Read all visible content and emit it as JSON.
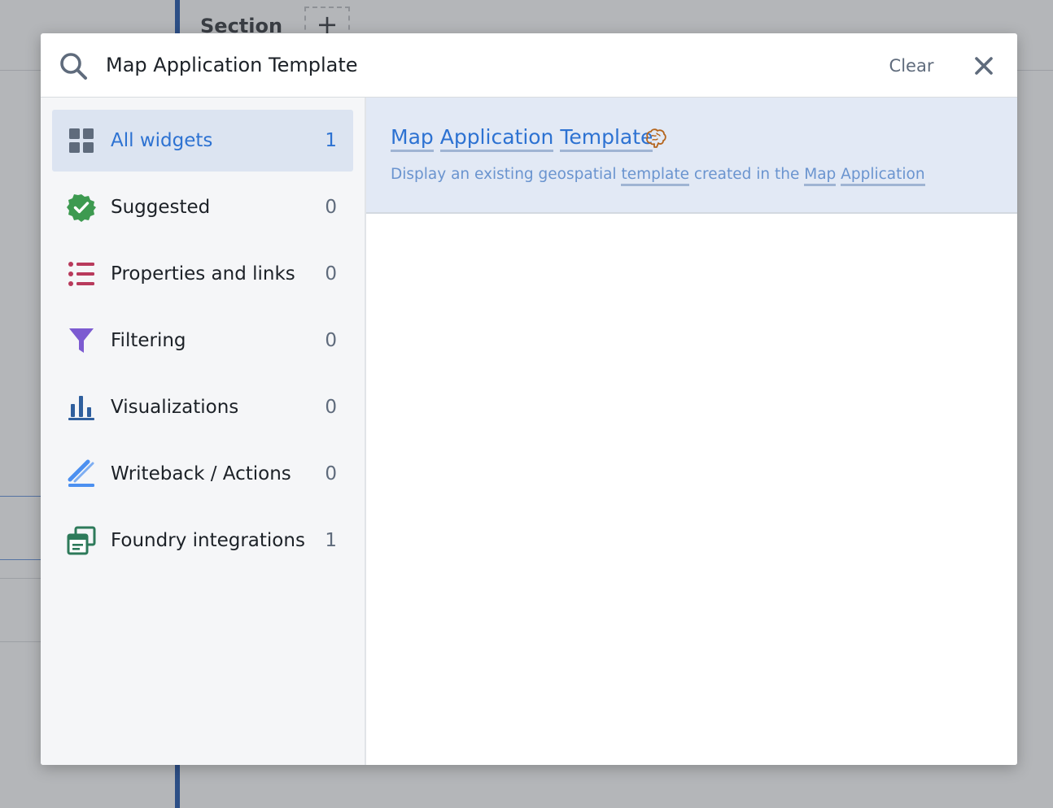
{
  "background": {
    "section_label": "Section",
    "add_symbol": "+"
  },
  "search": {
    "value": "Map Application Template",
    "clear_label": "Clear",
    "icon": "search-icon",
    "close_icon": "close-icon"
  },
  "categories": [
    {
      "label": "All widgets",
      "count": "1",
      "icon": "grid-icon",
      "active": true
    },
    {
      "label": "Suggested",
      "count": "0",
      "icon": "check-badge-icon",
      "color": "#3d9a50"
    },
    {
      "label": "Properties and links",
      "count": "0",
      "icon": "list-icon",
      "color": "#b83a5c"
    },
    {
      "label": "Filtering",
      "count": "0",
      "icon": "filter-icon",
      "color": "#7c5bd1"
    },
    {
      "label": "Visualizations",
      "count": "0",
      "icon": "bar-chart-icon",
      "color": "#2f5f9e"
    },
    {
      "label": "Writeback / Actions",
      "count": "0",
      "icon": "edit-icon",
      "color": "#4c90f0"
    },
    {
      "label": "Foundry integrations",
      "count": "1",
      "icon": "application-icon",
      "color": "#2d7a5a"
    }
  ],
  "results": [
    {
      "title_parts": [
        "Map",
        "Application",
        "Template"
      ],
      "description_parts": [
        "Display an existing geospatial",
        "template",
        "created in the",
        "Map",
        "Application"
      ],
      "icon": "brain-icon"
    }
  ],
  "colors": {
    "accent": "#2d72d2",
    "active_bg": "#dce4f1",
    "result_bg": "#e2e9f5"
  }
}
